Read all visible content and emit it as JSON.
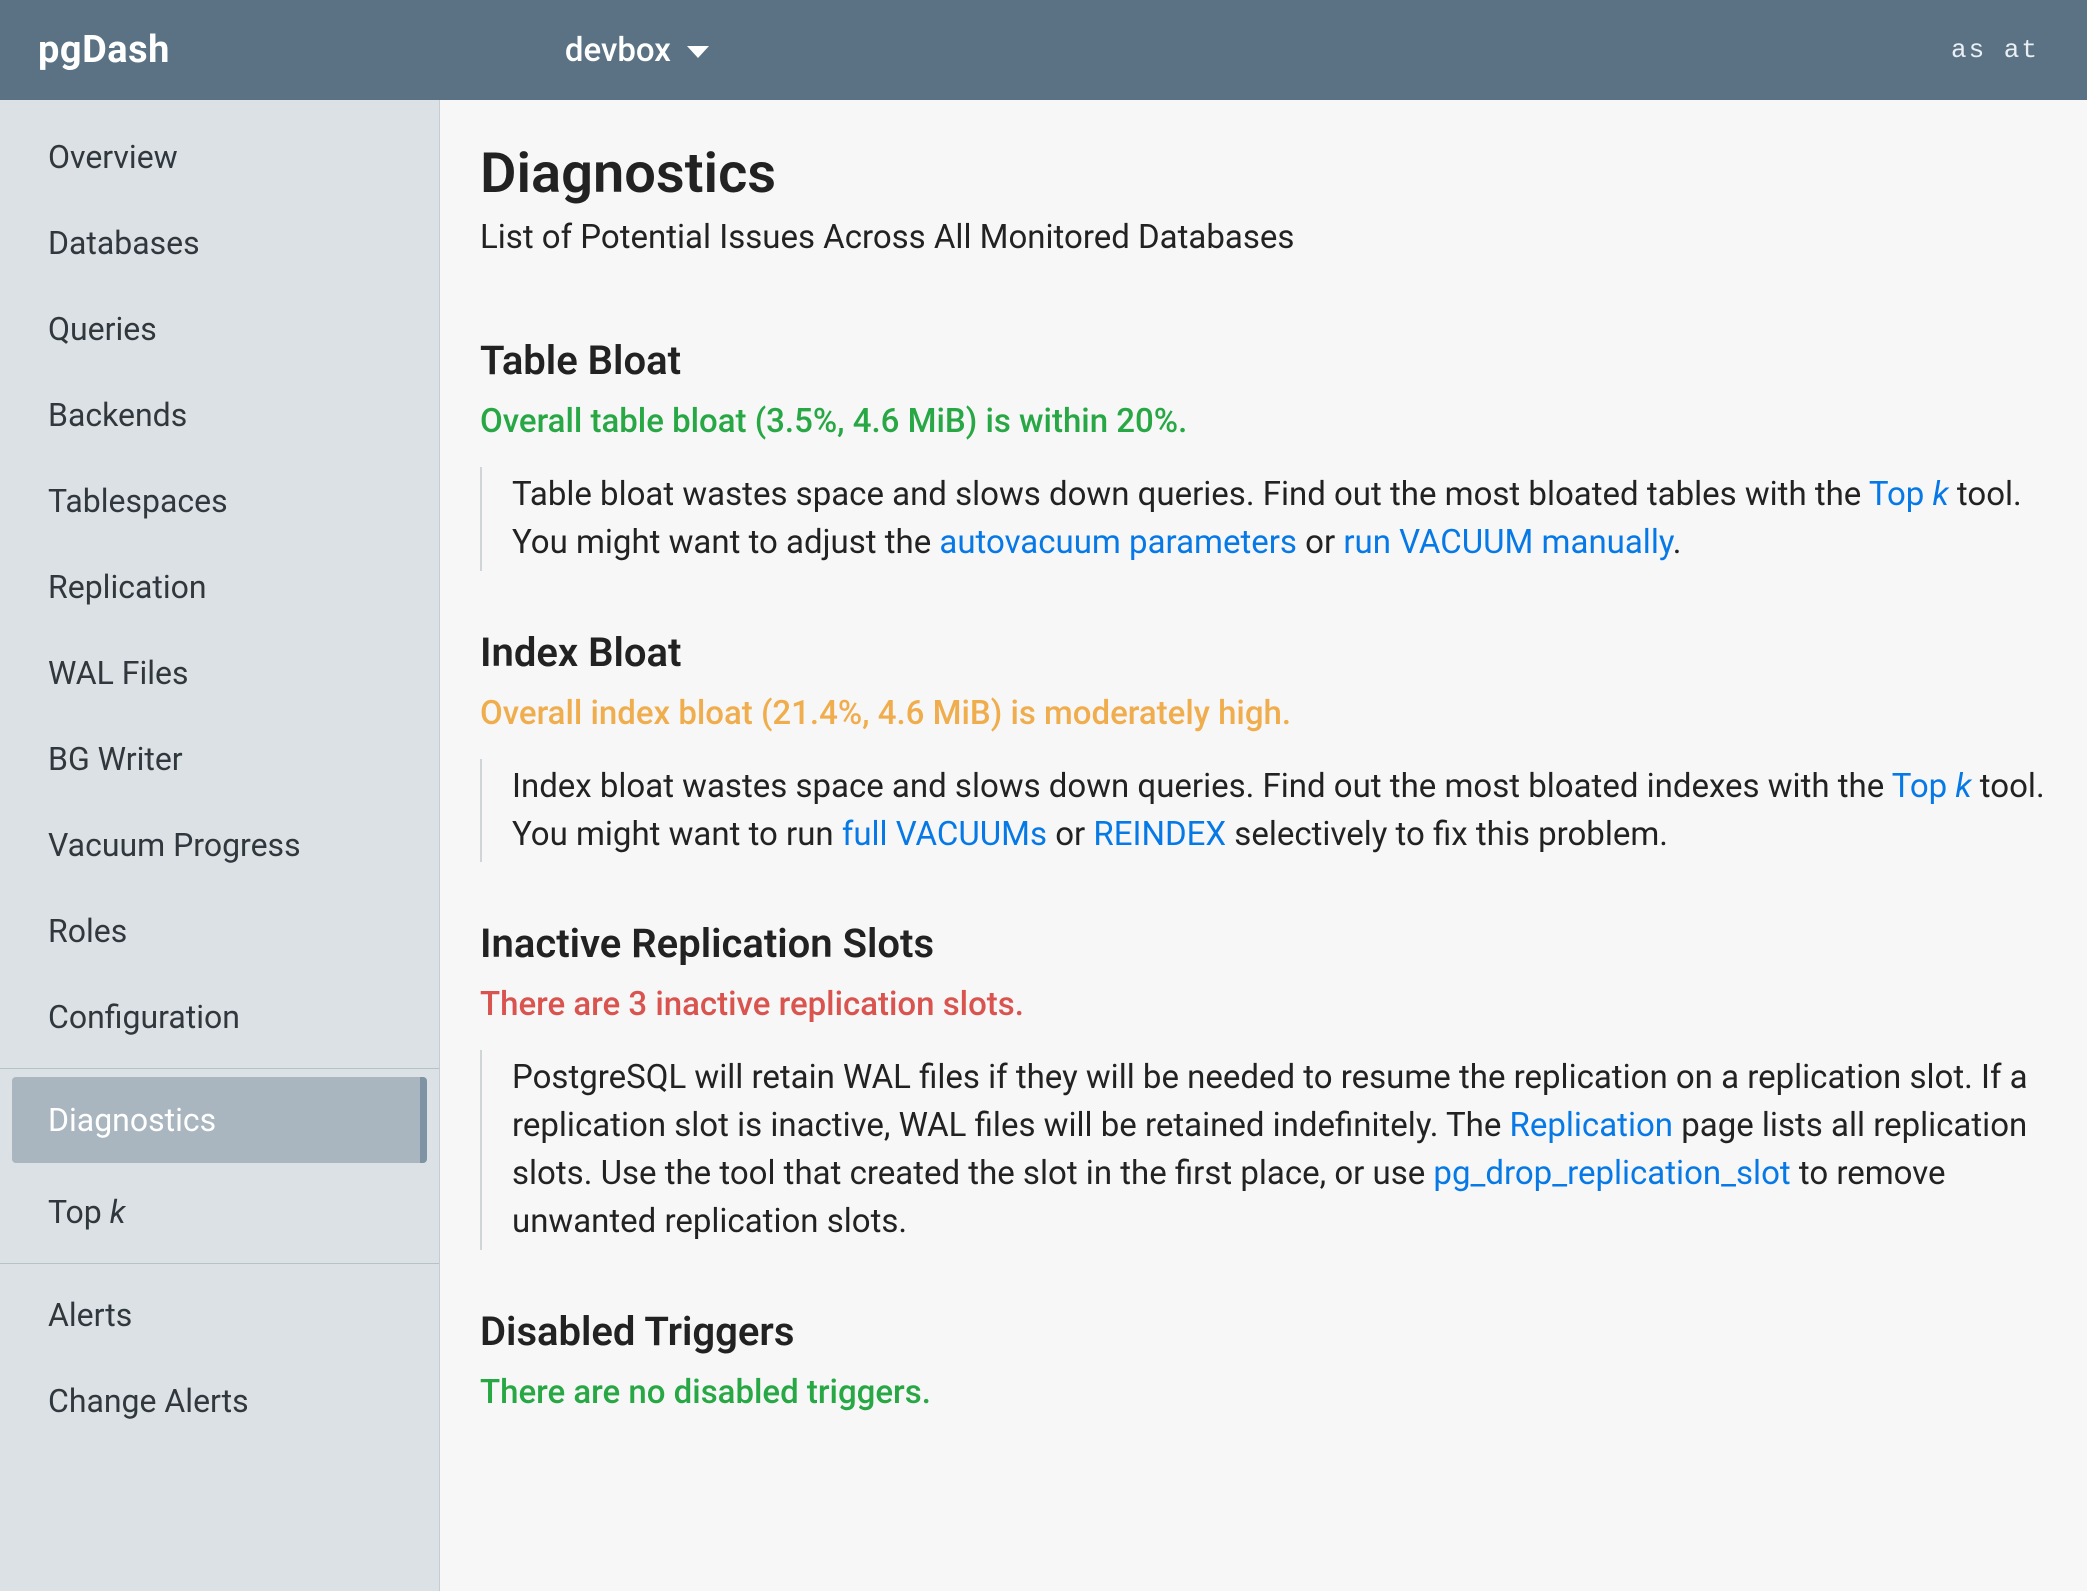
{
  "header": {
    "brand": "pgDash",
    "server": "devbox",
    "as_at": "as at"
  },
  "sidebar": {
    "group1": [
      {
        "label": "Overview"
      },
      {
        "label": "Databases"
      },
      {
        "label": "Queries"
      },
      {
        "label": "Backends"
      },
      {
        "label": "Tablespaces"
      },
      {
        "label": "Replication"
      },
      {
        "label": "WAL Files"
      },
      {
        "label": "BG Writer"
      },
      {
        "label": "Vacuum Progress"
      },
      {
        "label": "Roles"
      },
      {
        "label": "Configuration"
      }
    ],
    "group2": [
      {
        "label": "Diagnostics",
        "active": true
      },
      {
        "label_html": "Top <em>k</em>"
      }
    ],
    "group3": [
      {
        "label": "Alerts"
      },
      {
        "label": "Change Alerts"
      }
    ]
  },
  "page": {
    "title": "Diagnostics",
    "subtitle": "List of Potential Issues Across All Monitored Databases"
  },
  "sections": {
    "table_bloat": {
      "heading": "Table Bloat",
      "status": "Overall table bloat (3.5%, 4.6 MiB) is within 20%.",
      "status_class": "status-ok",
      "desc_parts": {
        "t1": "Table bloat wastes space and slows down queries. Find out the most bloated tables with the ",
        "link1": "Top ",
        "link1_em": "k",
        "t2": " tool. You might want to adjust the ",
        "link2": "autovacuum parameters",
        "t3": " or ",
        "link3": "run VACUUM manually",
        "t4": "."
      }
    },
    "index_bloat": {
      "heading": "Index Bloat",
      "status": "Overall index bloat (21.4%, 4.6 MiB) is moderately high.",
      "status_class": "status-warn",
      "desc_parts": {
        "t1": "Index bloat wastes space and slows down queries. Find out the most bloated indexes with the ",
        "link1": "Top ",
        "link1_em": "k",
        "t2": " tool. You might want to run ",
        "link2": "full VACUUMs",
        "t3": " or ",
        "link3": "REINDEX",
        "t4": " selectively to fix this problem."
      }
    },
    "inactive_slots": {
      "heading": "Inactive Replication Slots",
      "status": "There are 3 inactive replication slots.",
      "status_class": "status-err",
      "desc_parts": {
        "t1": "PostgreSQL will retain WAL files if they will be needed to resume the replication on a replication slot. If a replication slot is inactive, WAL files will be retained indefinitely. The ",
        "link1": "Replication",
        "t2": " page lists all replication slots. Use the tool that created the slot in the first place, or use ",
        "link2": "pg_drop_replication_slot",
        "t3": " to remove unwanted replication slots."
      }
    },
    "disabled_triggers": {
      "heading": "Disabled Triggers",
      "status": "There are no disabled triggers.",
      "status_class": "status-ok"
    }
  }
}
